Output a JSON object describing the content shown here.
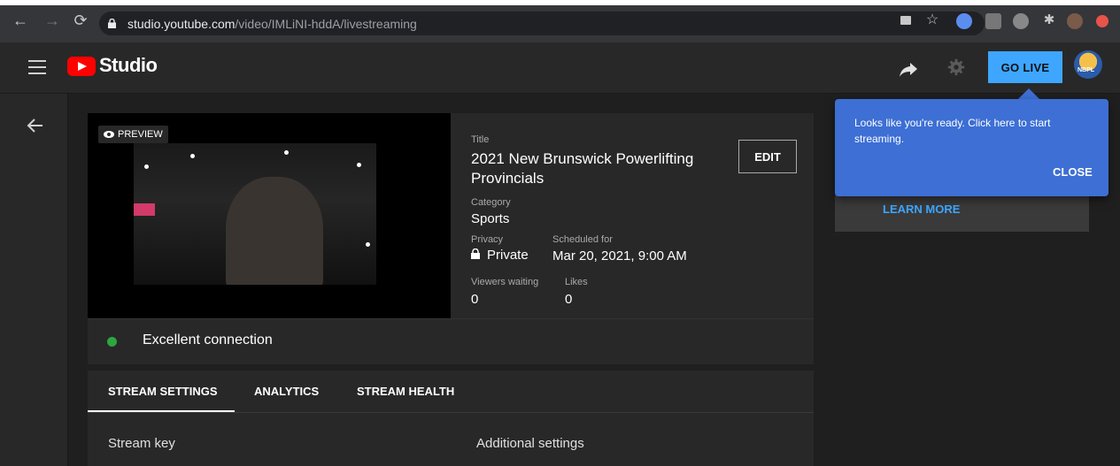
{
  "browser": {
    "url_host": "studio.youtube.com",
    "url_path": "/video/IMLiNI-hddA/livestreaming"
  },
  "header": {
    "app_name": "Studio",
    "go_live_label": "GO LIVE"
  },
  "preview": {
    "badge_label": "PREVIEW",
    "connection_status": "Excellent connection"
  },
  "details": {
    "title_label": "Title",
    "title_value": "2021 New Brunswick Powerlifting Provincials",
    "edit_label": "EDIT",
    "category_label": "Category",
    "category_value": "Sports",
    "privacy_label": "Privacy",
    "privacy_value": "Private",
    "scheduled_label": "Scheduled for",
    "scheduled_value": "Mar 20, 2021, 9:00 AM",
    "viewers_label": "Viewers waiting",
    "viewers_value": "0",
    "likes_label": "Likes",
    "likes_value": "0"
  },
  "tabs": [
    {
      "label": "STREAM SETTINGS"
    },
    {
      "label": "ANALYTICS"
    },
    {
      "label": "STREAM HEALTH"
    }
  ],
  "sections": {
    "stream_key": "Stream key",
    "additional": "Additional settings"
  },
  "right": {
    "learn_more": "LEARN MORE"
  },
  "popup": {
    "message": "Looks like you're ready. Click here to start streaming.",
    "close_label": "CLOSE"
  },
  "colors": {
    "accent": "#3ea6ff",
    "brand_red": "#ff0000",
    "popup": "#3d6fd4",
    "status_ok": "#2ba640"
  }
}
